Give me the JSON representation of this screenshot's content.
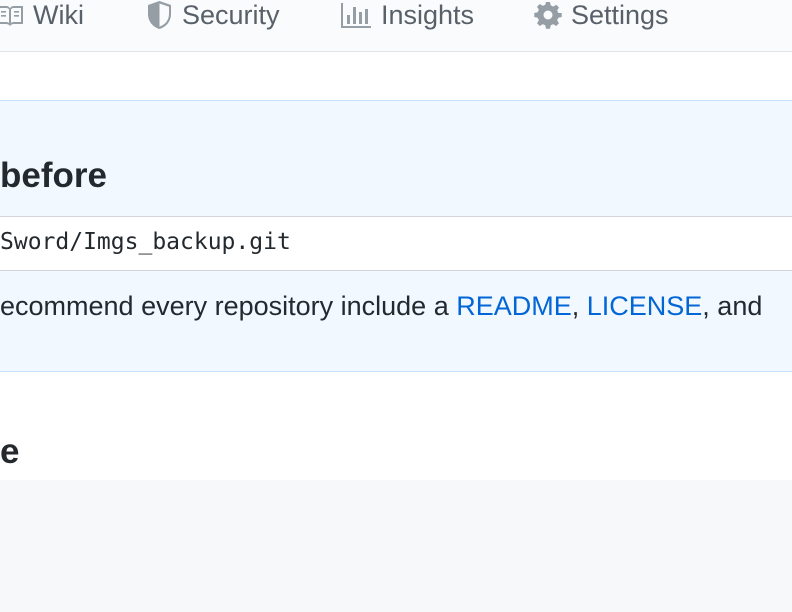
{
  "nav": {
    "tabs": [
      {
        "label": "Wiki",
        "icon": "book-icon"
      },
      {
        "label": "Security",
        "icon": "shield-icon"
      },
      {
        "label": "Insights",
        "icon": "graph-icon"
      },
      {
        "label": "Settings",
        "icon": "gear-icon"
      }
    ]
  },
  "setup": {
    "title": "before",
    "clone_url": "Sword/Imgs_backup.git",
    "recommend_prefix": "ecommend every repository include a ",
    "readme_link": "README",
    "sep": ", ",
    "license_link": "LICENSE",
    "recommend_suffix": ", and"
  },
  "section": {
    "title": "e"
  },
  "colors": {
    "link": "#0366d6",
    "setup_bg": "#f1f8ff",
    "setup_border": "#c8e1ff",
    "nav_bg": "#fafbfc",
    "footer_bg": "#f6f8fa"
  }
}
